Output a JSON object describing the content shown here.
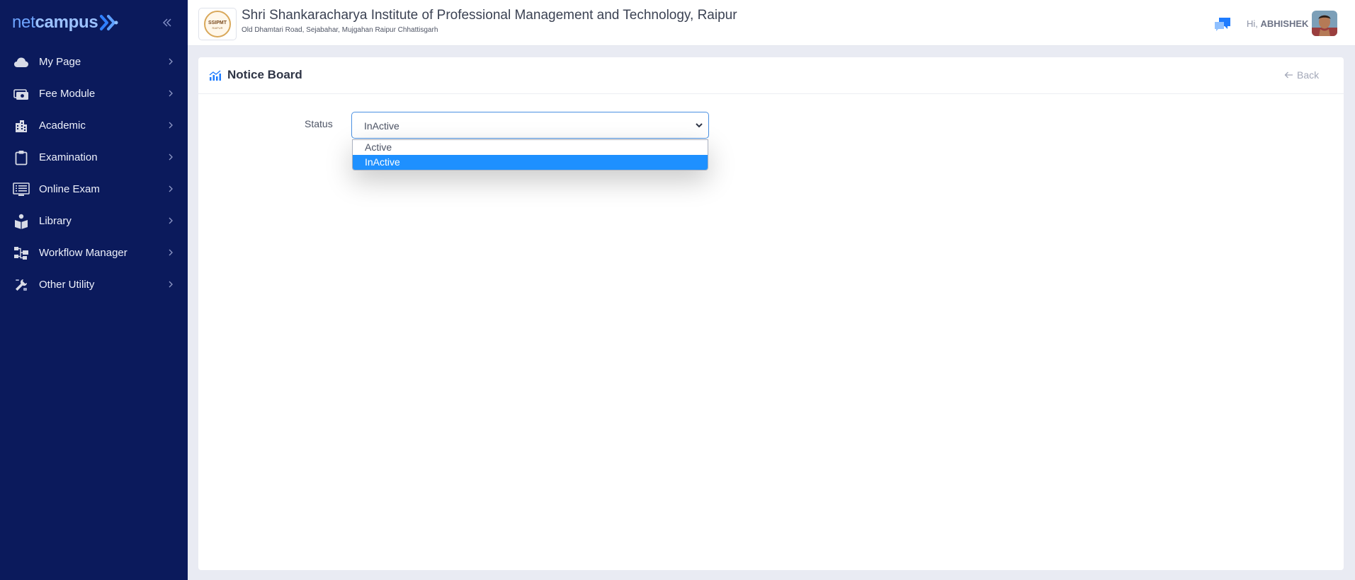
{
  "brand": {
    "net": "net",
    "campus": "campus"
  },
  "sidebar": {
    "items": [
      {
        "label": "My Page",
        "icon": "cloud-icon"
      },
      {
        "label": "Fee Module",
        "icon": "money-icon"
      },
      {
        "label": "Academic",
        "icon": "building-icon"
      },
      {
        "label": "Examination",
        "icon": "clipboard-icon"
      },
      {
        "label": "Online Exam",
        "icon": "monitor-list-icon"
      },
      {
        "label": "Library",
        "icon": "book-reader-icon"
      },
      {
        "label": "Workflow Manager",
        "icon": "workflow-icon"
      },
      {
        "label": "Other Utility",
        "icon": "tools-icon"
      }
    ]
  },
  "header": {
    "institute_name": "Shri Shankaracharya Institute of Professional Management and Technology, Raipur",
    "address": "Old Dhamtari Road, Sejabahar, Mujgahan Raipur Chhattisgarh",
    "logo_text": "SSIPMT",
    "logo_subtext": "RAIPUR",
    "greeting_prefix": "Hi,",
    "user_name": "ABHISHEK"
  },
  "page": {
    "title": "Notice Board",
    "back_label": "Back",
    "status_label": "Status",
    "status_value": "InActive",
    "status_options": [
      "Active",
      "InActive"
    ]
  },
  "colors": {
    "sidebar_bg": "#0b1a5c",
    "accent": "#1e90ff",
    "page_bg": "#e9ebf3"
  }
}
